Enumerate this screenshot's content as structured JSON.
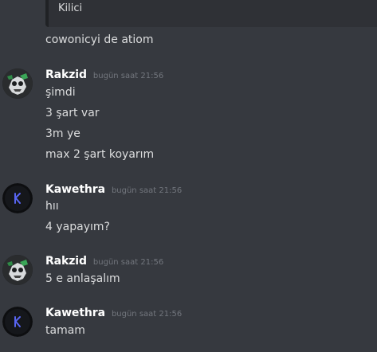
{
  "reply_embed": {
    "text": "Kilici"
  },
  "continuation": {
    "text": "cowonicyi de atiom"
  },
  "groups": [
    {
      "username": "Rakzid",
      "timestamp": "bugün saat 21:56",
      "avatar_icon": "skull-mask-avatar",
      "messages": [
        "şimdi",
        "3 şart var",
        "3m ye",
        "max 2 şart koyarım"
      ]
    },
    {
      "username": "Kawethra",
      "timestamp": "bugün saat 21:56",
      "avatar_icon": "letter-k-avatar",
      "messages": [
        "hıı",
        "4 yapayım?"
      ]
    },
    {
      "username": "Rakzid",
      "timestamp": "bugün saat 21:56",
      "avatar_icon": "skull-mask-avatar",
      "messages": [
        "5 e anlaşalım"
      ]
    },
    {
      "username": "Kawethra",
      "timestamp": "bugün saat 21:56",
      "avatar_icon": "letter-k-avatar",
      "messages": [
        "tamam"
      ]
    }
  ],
  "colors": {
    "background": "#36393f",
    "text": "#dcddde",
    "username": "#ffffff",
    "timestamp": "#72767d",
    "embed": "#2f3136"
  }
}
